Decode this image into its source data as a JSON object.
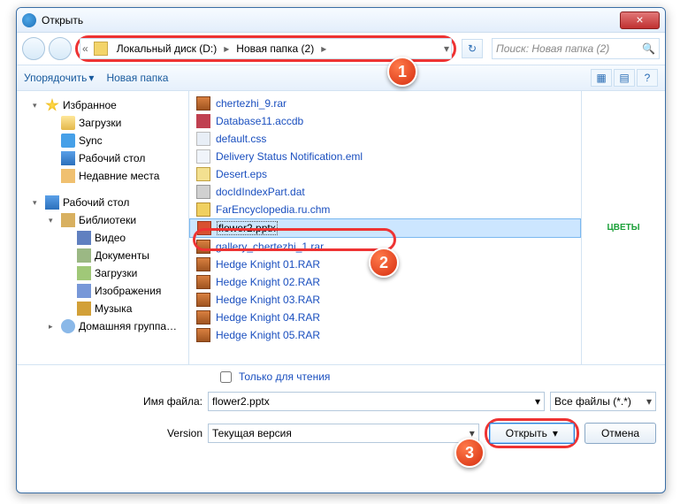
{
  "window": {
    "title": "Открыть",
    "close_glyph": "×"
  },
  "nav": {
    "back_chevron": "«",
    "segments": [
      "Локальный диск (D:)",
      "Новая папка (2)"
    ],
    "chevron": "▸",
    "refresh_glyph": "↻",
    "dropdown_glyph": "▾"
  },
  "search": {
    "placeholder": "Поиск: Новая папка (2)",
    "icon": "🔍"
  },
  "toolbar": {
    "organize": "Упорядочить",
    "new_folder": "Новая папка",
    "view_icons": "▦",
    "view_list": "▤",
    "help": "?"
  },
  "sidebar": {
    "groups": [
      {
        "icon": "star",
        "label": "Избранное",
        "exp": true,
        "level": 1,
        "children": [
          {
            "icon": "folder",
            "label": "Загрузки",
            "level": 2
          },
          {
            "icon": "sync",
            "label": "Sync",
            "level": 2
          },
          {
            "icon": "desk",
            "label": "Рабочий стол",
            "level": 2
          },
          {
            "icon": "recent",
            "label": "Недавние места",
            "level": 2
          }
        ]
      },
      {
        "icon": "desk",
        "label": "Рабочий стол",
        "exp": true,
        "level": 1,
        "children": [
          {
            "icon": "lib",
            "label": "Библиотеки",
            "exp": true,
            "level": 2,
            "children": [
              {
                "icon": "vid",
                "label": "Видео",
                "level": 3
              },
              {
                "icon": "doc",
                "label": "Документы",
                "level": 3
              },
              {
                "icon": "dl",
                "label": "Загрузки",
                "level": 3
              },
              {
                "icon": "img",
                "label": "Изображения",
                "level": 3
              },
              {
                "icon": "mus",
                "label": "Музыка",
                "level": 3
              }
            ]
          },
          {
            "icon": "home",
            "label": "Домашняя группа…",
            "exp": false,
            "level": 2
          }
        ]
      }
    ]
  },
  "files": [
    {
      "icon": "rar",
      "name": "chertezhi_9.rar"
    },
    {
      "icon": "db",
      "name": "Database11.accdb"
    },
    {
      "icon": "css",
      "name": "default.css"
    },
    {
      "icon": "eml",
      "name": "Delivery Status Notification.eml"
    },
    {
      "icon": "eps",
      "name": "Desert.eps"
    },
    {
      "icon": "dat",
      "name": "docIdIndexPart.dat"
    },
    {
      "icon": "chm",
      "name": "FarEncyclopedia.ru.chm"
    },
    {
      "icon": "pptx",
      "name": "flower2.pptx",
      "selected": true
    },
    {
      "icon": "rar",
      "name": "gallery_chertezhi_1.rar"
    },
    {
      "icon": "rar",
      "name": "Hedge Knight 01.RAR"
    },
    {
      "icon": "rar",
      "name": "Hedge Knight 02.RAR"
    },
    {
      "icon": "rar",
      "name": "Hedge Knight 03.RAR"
    },
    {
      "icon": "rar",
      "name": "Hedge Knight 04.RAR"
    },
    {
      "icon": "rar",
      "name": "Hedge Knight 05.RAR"
    }
  ],
  "preview": {
    "text": "ЦВЕТЫ"
  },
  "readonly": {
    "label": "Только для чтения"
  },
  "filename": {
    "label": "Имя файла:",
    "value": "flower2.pptx",
    "dd": "▾"
  },
  "filter": {
    "value": "Все файлы (*.*)",
    "dd": "▾"
  },
  "version": {
    "label": "Version",
    "value": "Текущая версия",
    "dd": "▾"
  },
  "buttons": {
    "open": "Открыть",
    "cancel": "Отмена",
    "open_dd": "▾"
  },
  "badges": {
    "b1": "1",
    "b2": "2",
    "b3": "3"
  }
}
